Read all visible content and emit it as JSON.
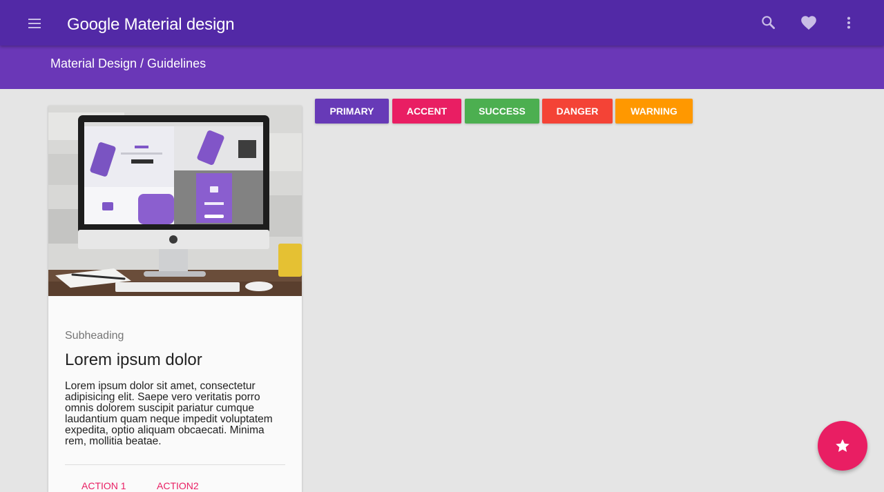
{
  "appbar": {
    "title": "Google Material design",
    "color": "#5229a6",
    "menu_icon": "menu-icon",
    "actions": [
      "search-icon",
      "heart-icon",
      "more-vert-icon"
    ]
  },
  "subbar": {
    "breadcrumb": "Material Design / Guidelines",
    "color": "#6a37b7"
  },
  "card": {
    "image": "desktop-mockup-image",
    "subheading": "Subheading",
    "title": "Lorem ipsum dolor",
    "text": "Lorem ipsum dolor sit amet, consectetur adipisicing elit. Saepe vero veritatis porro omnis dolorem suscipit pariatur cumque laudantium quam neque impedit voluptatem expedita, optio aliquam obcaecati. Minima rem, mollitia beatae.",
    "actions": [
      "ACTION 1",
      "ACTION2"
    ]
  },
  "buttons": [
    {
      "label": "PRIMARY",
      "color": "#673ab7"
    },
    {
      "label": "ACCENT",
      "color": "#e91e63"
    },
    {
      "label": "SUCCESS",
      "color": "#4caf50"
    },
    {
      "label": "DANGER",
      "color": "#f44336"
    },
    {
      "label": "WARNING",
      "color": "#ff9800"
    }
  ],
  "fab": {
    "icon": "star-icon",
    "color": "#e91e63"
  }
}
